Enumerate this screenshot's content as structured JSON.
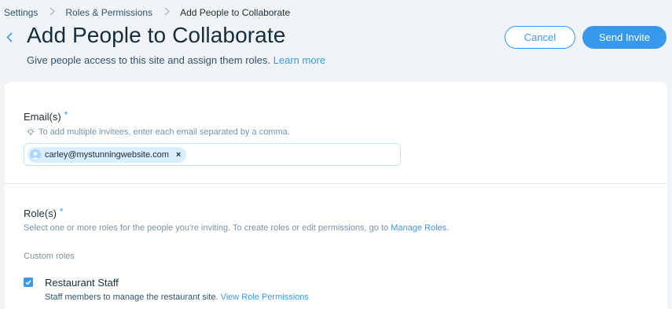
{
  "breadcrumb": {
    "items": [
      "Settings",
      "Roles & Permissions",
      "Add People to Collaborate"
    ]
  },
  "header": {
    "title": "Add People to Collaborate",
    "subtitle": "Give people access to this site and assign them roles.",
    "learn_more": "Learn more",
    "cancel_label": "Cancel",
    "send_label": "Send Invite"
  },
  "email_section": {
    "label": "Email(s)",
    "required_mark": "*",
    "hint": "To add multiple invitees, enter each email separated by a comma.",
    "tags": [
      {
        "email": "carley@mystunningwebsite.com",
        "remove": "×"
      }
    ]
  },
  "roles_section": {
    "label": "Role(s)",
    "required_mark": "*",
    "description": "Select one or more roles for the people you're inviting. To create roles or edit permissions, go to",
    "manage_roles_link": "Manage Roles",
    "description_end": ".",
    "custom_roles_heading": "Custom roles",
    "roles": [
      {
        "name": "Restaurant Staff",
        "checked": true,
        "description": "Staff members to manage the restaurant site.",
        "permissions_link": "View Role Permissions"
      }
    ]
  },
  "colors": {
    "accent": "#3899ec",
    "background": "#f0f4f7",
    "title": "#162d3d"
  },
  "icons": [
    "chevron-right-icon",
    "chevron-left-icon",
    "lightbulb-icon",
    "user-avatar-icon",
    "close-icon",
    "checkmark-icon"
  ]
}
